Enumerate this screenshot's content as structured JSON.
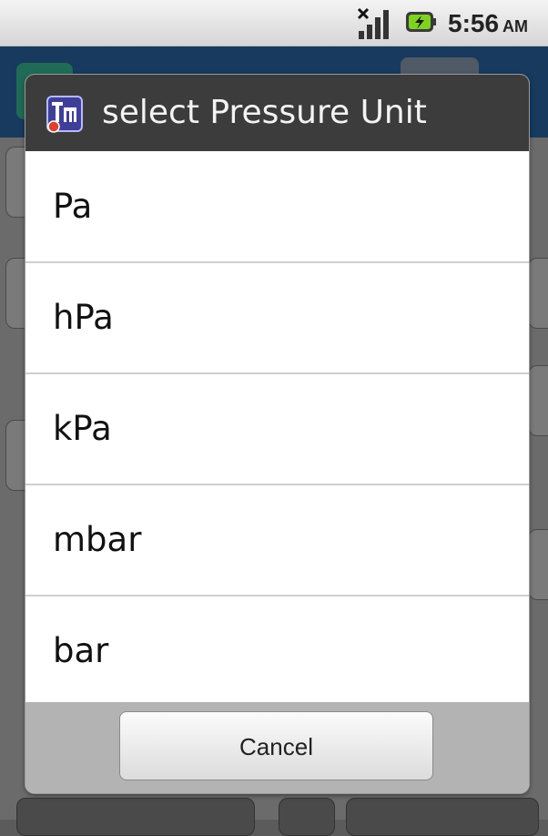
{
  "status_bar": {
    "time": "5:56",
    "ampm": "AM",
    "icons": [
      "no-signal-icon",
      "battery-charging-icon"
    ]
  },
  "dialog": {
    "app_icon": "app-logo-icon",
    "title": "select Pressure Unit",
    "options": [
      "Pa",
      "hPa",
      "kPa",
      "mbar",
      "bar"
    ],
    "cancel_label": "Cancel"
  },
  "colors": {
    "title_bar": "#3c3c3c",
    "list_background": "#ffffff",
    "footer": "#b3b3b3",
    "background_header": "#173a5e"
  }
}
